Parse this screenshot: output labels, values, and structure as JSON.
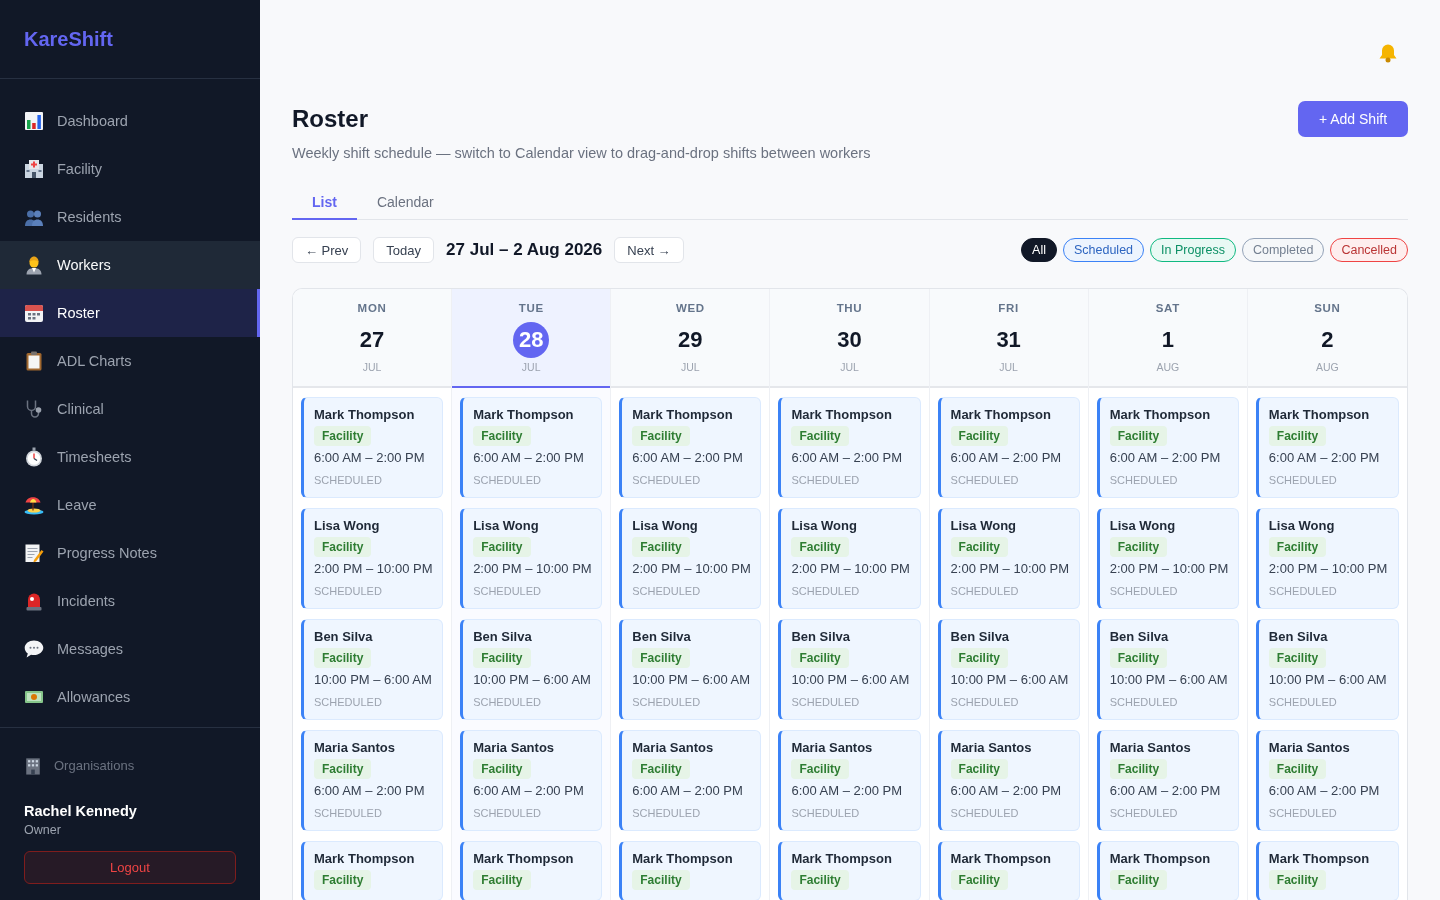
{
  "sidebar": {
    "logo": "KareShift",
    "nav_items": [
      {
        "label": "Dashboard",
        "selected": false,
        "hovered": false
      },
      {
        "label": "Facility",
        "selected": false,
        "hovered": false
      },
      {
        "label": "Residents",
        "selected": false,
        "hovered": false
      },
      {
        "label": "Workers",
        "selected": false,
        "hovered": true
      },
      {
        "label": "Roster",
        "selected": true,
        "hovered": false
      },
      {
        "label": "ADL Charts",
        "selected": false,
        "hovered": false
      },
      {
        "label": "Clinical",
        "selected": false,
        "hovered": false
      },
      {
        "label": "Timesheets",
        "selected": false,
        "hovered": false
      },
      {
        "label": "Leave",
        "selected": false,
        "hovered": false
      },
      {
        "label": "Progress Notes",
        "selected": false,
        "hovered": false
      },
      {
        "label": "Incidents",
        "selected": false,
        "hovered": false
      },
      {
        "label": "Messages",
        "selected": false,
        "hovered": false
      },
      {
        "label": "Allowances",
        "selected": false,
        "hovered": false
      }
    ],
    "organisations_link": "Organisations",
    "user": {
      "name": "Rachel Kennedy",
      "role": "Owner"
    },
    "logout_button": "Logout"
  },
  "header": {
    "title": "Roster",
    "subtitle": "Weekly shift schedule — switch to Calendar view to drag-and-drop shifts between workers",
    "add_button": "+ Add Shift"
  },
  "view_tabs": [
    {
      "label": "List",
      "selected": true
    },
    {
      "label": "Calendar",
      "selected": false
    }
  ],
  "toolbar": {
    "prev_button": "← Prev",
    "today_button": "Today",
    "date_range": "27 Jul – 2 Aug 2026",
    "next_button": "Next →"
  },
  "filters": [
    {
      "label": "All",
      "selected": true,
      "color": "#111827"
    },
    {
      "label": "Scheduled",
      "selected": false,
      "color": "#3b82f6"
    },
    {
      "label": "In Progress",
      "selected": false,
      "color": "#10b981"
    },
    {
      "label": "Completed",
      "selected": false,
      "color": "#94a3b8"
    },
    {
      "label": "Cancelled",
      "selected": false,
      "color": "#ef4444"
    }
  ],
  "days": [
    {
      "weekday": "MON",
      "day": "27",
      "month": "JUL",
      "today": false,
      "shifts": [
        {
          "worker": "Mark Thompson",
          "location": "Facility",
          "time": "6:00 AM – 2:00 PM",
          "status": "SCHEDULED"
        },
        {
          "worker": "Lisa Wong",
          "location": "Facility",
          "time": "2:00 PM – 10:00 PM",
          "status": "SCHEDULED"
        },
        {
          "worker": "Ben Silva",
          "location": "Facility",
          "time": "10:00 PM – 6:00 AM",
          "status": "SCHEDULED"
        },
        {
          "worker": "Maria Santos",
          "location": "Facility",
          "time": "6:00 AM – 2:00 PM",
          "status": "SCHEDULED"
        },
        {
          "worker": "Mark Thompson",
          "location": "Facility"
        }
      ]
    },
    {
      "weekday": "TUE",
      "day": "28",
      "month": "JUL",
      "today": true,
      "shifts": [
        {
          "worker": "Mark Thompson",
          "location": "Facility",
          "time": "6:00 AM – 2:00 PM",
          "status": "SCHEDULED"
        },
        {
          "worker": "Lisa Wong",
          "location": "Facility",
          "time": "2:00 PM – 10:00 PM",
          "status": "SCHEDULED"
        },
        {
          "worker": "Ben Silva",
          "location": "Facility",
          "time": "10:00 PM – 6:00 AM",
          "status": "SCHEDULED"
        },
        {
          "worker": "Maria Santos",
          "location": "Facility",
          "time": "6:00 AM – 2:00 PM",
          "status": "SCHEDULED"
        },
        {
          "worker": "Mark Thompson",
          "location": "Facility"
        }
      ]
    },
    {
      "weekday": "WED",
      "day": "29",
      "month": "JUL",
      "today": false,
      "shifts": [
        {
          "worker": "Mark Thompson",
          "location": "Facility",
          "time": "6:00 AM – 2:00 PM",
          "status": "SCHEDULED"
        },
        {
          "worker": "Lisa Wong",
          "location": "Facility",
          "time": "2:00 PM – 10:00 PM",
          "status": "SCHEDULED"
        },
        {
          "worker": "Ben Silva",
          "location": "Facility",
          "time": "10:00 PM – 6:00 AM",
          "status": "SCHEDULED"
        },
        {
          "worker": "Maria Santos",
          "location": "Facility",
          "time": "6:00 AM – 2:00 PM",
          "status": "SCHEDULED"
        },
        {
          "worker": "Mark Thompson",
          "location": "Facility"
        }
      ]
    },
    {
      "weekday": "THU",
      "day": "30",
      "month": "JUL",
      "today": false,
      "shifts": [
        {
          "worker": "Mark Thompson",
          "location": "Facility",
          "time": "6:00 AM – 2:00 PM",
          "status": "SCHEDULED"
        },
        {
          "worker": "Lisa Wong",
          "location": "Facility",
          "time": "2:00 PM – 10:00 PM",
          "status": "SCHEDULED"
        },
        {
          "worker": "Ben Silva",
          "location": "Facility",
          "time": "10:00 PM – 6:00 AM",
          "status": "SCHEDULED"
        },
        {
          "worker": "Maria Santos",
          "location": "Facility",
          "time": "6:00 AM – 2:00 PM",
          "status": "SCHEDULED"
        },
        {
          "worker": "Mark Thompson",
          "location": "Facility"
        }
      ]
    },
    {
      "weekday": "FRI",
      "day": "31",
      "month": "JUL",
      "today": false,
      "shifts": [
        {
          "worker": "Mark Thompson",
          "location": "Facility",
          "time": "6:00 AM – 2:00 PM",
          "status": "SCHEDULED"
        },
        {
          "worker": "Lisa Wong",
          "location": "Facility",
          "time": "2:00 PM – 10:00 PM",
          "status": "SCHEDULED"
        },
        {
          "worker": "Ben Silva",
          "location": "Facility",
          "time": "10:00 PM – 6:00 AM",
          "status": "SCHEDULED"
        },
        {
          "worker": "Maria Santos",
          "location": "Facility",
          "time": "6:00 AM – 2:00 PM",
          "status": "SCHEDULED"
        },
        {
          "worker": "Mark Thompson",
          "location": "Facility"
        }
      ]
    },
    {
      "weekday": "SAT",
      "day": "1",
      "month": "AUG",
      "today": false,
      "shifts": [
        {
          "worker": "Mark Thompson",
          "location": "Facility",
          "time": "6:00 AM – 2:00 PM",
          "status": "SCHEDULED"
        },
        {
          "worker": "Lisa Wong",
          "location": "Facility",
          "time": "2:00 PM – 10:00 PM",
          "status": "SCHEDULED"
        },
        {
          "worker": "Ben Silva",
          "location": "Facility",
          "time": "10:00 PM – 6:00 AM",
          "status": "SCHEDULED"
        },
        {
          "worker": "Maria Santos",
          "location": "Facility",
          "time": "6:00 AM – 2:00 PM",
          "status": "SCHEDULED"
        },
        {
          "worker": "Mark Thompson",
          "location": "Facility"
        }
      ]
    },
    {
      "weekday": "SUN",
      "day": "2",
      "month": "AUG",
      "today": false,
      "shifts": [
        {
          "worker": "Mark Thompson",
          "location": "Facility",
          "time": "6:00 AM – 2:00 PM",
          "status": "SCHEDULED"
        },
        {
          "worker": "Lisa Wong",
          "location": "Facility",
          "time": "2:00 PM – 10:00 PM",
          "status": "SCHEDULED"
        },
        {
          "worker": "Ben Silva",
          "location": "Facility",
          "time": "10:00 PM – 6:00 AM",
          "status": "SCHEDULED"
        },
        {
          "worker": "Maria Santos",
          "location": "Facility",
          "time": "6:00 AM – 2:00 PM",
          "status": "SCHEDULED"
        },
        {
          "worker": "Mark Thompson",
          "location": "Facility"
        }
      ]
    }
  ]
}
